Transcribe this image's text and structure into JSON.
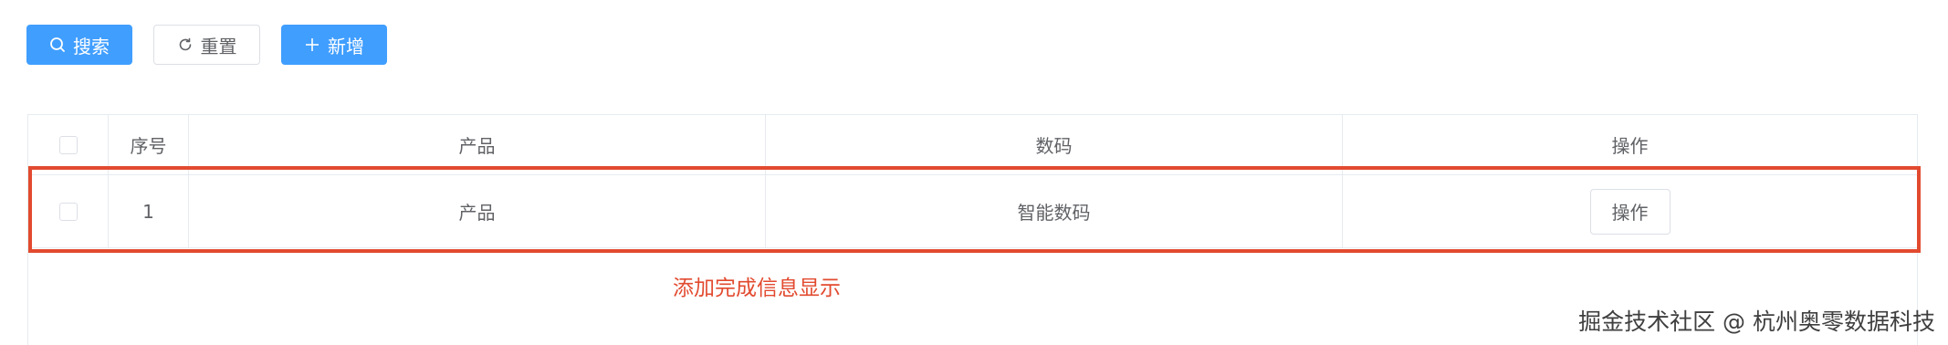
{
  "toolbar": {
    "search_label": "搜索",
    "reset_label": "重置",
    "add_label": "新增"
  },
  "table": {
    "columns": [
      "序号",
      "产品",
      "数码",
      "操作"
    ],
    "rows": [
      {
        "index": "1",
        "product": "产品",
        "digital": "智能数码",
        "action": "操作"
      }
    ]
  },
  "annotation": "添加完成信息显示",
  "watermark": "掘金技术社区 @ 杭州奥零数据科技",
  "colors": {
    "primary": "#409eff",
    "highlight": "#e24a2f",
    "border": "#dcdfe6"
  }
}
